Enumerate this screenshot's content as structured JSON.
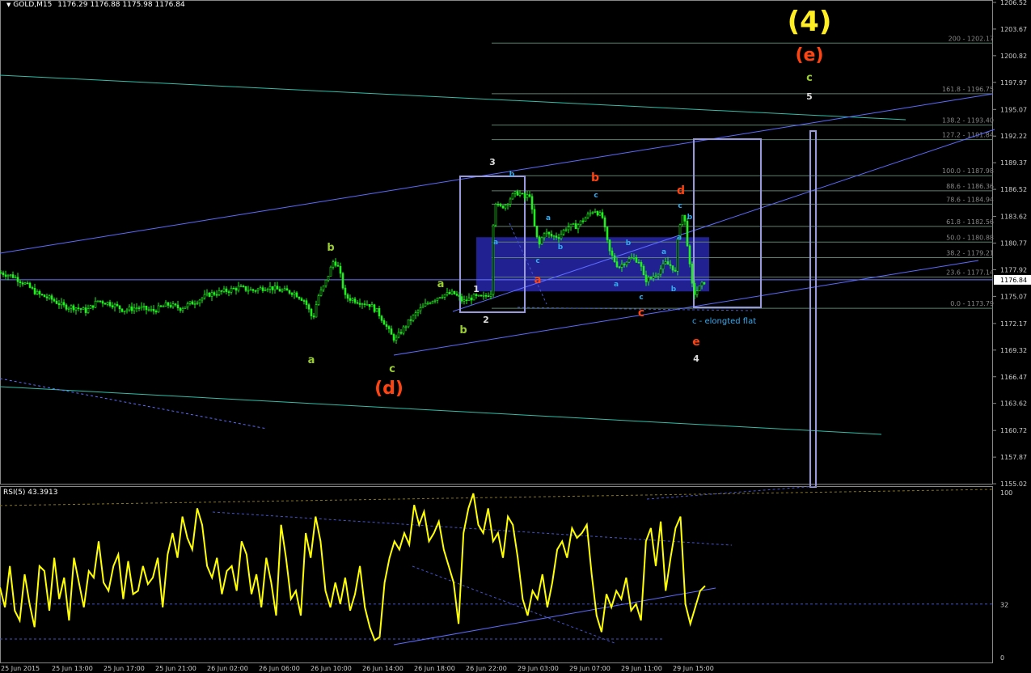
{
  "header": {
    "symbol": "GOLD,M15",
    "ohlc": "1176.29 1176.88 1175.98 1176.84",
    "rsi_label": "RSI(5) 43.3913"
  },
  "colors": {
    "background": "#000000",
    "candles": "#22ee22",
    "channel": "#5c6cff",
    "fib": "#5f7f6f",
    "box": "#9999dd",
    "zone": "#23239a",
    "rsi": "#ffff00",
    "count_green": "#9acd32",
    "count_red": "#ff4411",
    "count_cyan": "#33aaee",
    "wave4": "#ffee22"
  },
  "chart_data": [
    {
      "type": "line",
      "title": "GOLD,M15",
      "ylim": [
        1153.2,
        1207.5
      ],
      "y_ticks": [
        "1206.52",
        "1203.67",
        "1200.82",
        "1197.97",
        "1195.07",
        "1192.22",
        "1189.37",
        "1186.52",
        "1183.62",
        "1180.77",
        "1177.92",
        "1175.07",
        "1172.17",
        "1169.32",
        "1166.47",
        "1163.62",
        "1160.72",
        "1157.87",
        "1155.02"
      ],
      "current_price": "1176.84",
      "x_labels": [
        "25 Jun 2015",
        "25 Jun 13:00",
        "25 Jun 17:00",
        "25 Jun 21:00",
        "26 Jun 02:00",
        "26 Jun 06:00",
        "26 Jun 10:00",
        "26 Jun 14:00",
        "26 Jun 18:00",
        "26 Jun 22:00",
        "29 Jun 03:00",
        "29 Jun 07:00",
        "29 Jun 11:00",
        "29 Jun 15:00"
      ],
      "price_path": [
        [
          0,
          1177.6
        ],
        [
          16,
          1177.2
        ],
        [
          30,
          1176.4
        ],
        [
          46,
          1175.3
        ],
        [
          62,
          1174.8
        ],
        [
          78,
          1174.0
        ],
        [
          92,
          1173.9
        ],
        [
          106,
          1173.5
        ],
        [
          120,
          1174.6
        ],
        [
          136,
          1174.3
        ],
        [
          152,
          1173.6
        ],
        [
          170,
          1173.9
        ],
        [
          188,
          1173.5
        ],
        [
          206,
          1174.2
        ],
        [
          222,
          1173.8
        ],
        [
          240,
          1174.5
        ],
        [
          258,
          1175.3
        ],
        [
          276,
          1175.6
        ],
        [
          294,
          1176.0
        ],
        [
          312,
          1175.7
        ],
        [
          330,
          1176.1
        ],
        [
          346,
          1175.7
        ],
        [
          362,
          1175.5
        ],
        [
          376,
          1174.6
        ],
        [
          386,
          1172.6
        ],
        [
          392,
          1175.0
        ],
        [
          400,
          1176.2
        ],
        [
          406,
          1177.6
        ],
        [
          412,
          1179.0
        ],
        [
          418,
          1178.0
        ],
        [
          426,
          1175.0
        ],
        [
          440,
          1174.6
        ],
        [
          456,
          1174.2
        ],
        [
          466,
          1173.4
        ],
        [
          474,
          1172.3
        ],
        [
          482,
          1171.0
        ],
        [
          488,
          1170.4
        ],
        [
          494,
          1171.2
        ],
        [
          504,
          1172.3
        ],
        [
          516,
          1173.5
        ],
        [
          530,
          1174.5
        ],
        [
          544,
          1175.2
        ],
        [
          560,
          1175.4
        ],
        [
          572,
          1174.5
        ],
        [
          584,
          1175.0
        ],
        [
          596,
          1174.9
        ],
        [
          606,
          1175.5
        ],
        [
          610,
          1185.5
        ],
        [
          616,
          1184.5
        ],
        [
          624,
          1184.9
        ],
        [
          632,
          1185.8
        ],
        [
          640,
          1186.2
        ],
        [
          648,
          1185.6
        ],
        [
          654,
          1186.0
        ],
        [
          658,
          1183.5
        ],
        [
          662,
          1181.5
        ],
        [
          666,
          1180.6
        ],
        [
          672,
          1182.0
        ],
        [
          680,
          1181.5
        ],
        [
          690,
          1181.5
        ],
        [
          700,
          1182.5
        ],
        [
          712,
          1182.6
        ],
        [
          722,
          1183.4
        ],
        [
          734,
          1184.4
        ],
        [
          744,
          1183.5
        ],
        [
          752,
          1180.0
        ],
        [
          758,
          1179.0
        ],
        [
          764,
          1178.2
        ],
        [
          772,
          1178.8
        ],
        [
          782,
          1179.2
        ],
        [
          790,
          1178.8
        ],
        [
          796,
          1176.8
        ],
        [
          804,
          1177.0
        ],
        [
          814,
          1177.8
        ],
        [
          822,
          1178.6
        ],
        [
          830,
          1178.3
        ],
        [
          834,
          1177.6
        ],
        [
          838,
          1182.0
        ],
        [
          842,
          1184.0
        ],
        [
          846,
          1183.0
        ],
        [
          850,
          1180.0
        ],
        [
          854,
          1176.5
        ],
        [
          858,
          1175.4
        ],
        [
          864,
          1176.0
        ],
        [
          872,
          1176.84
        ]
      ],
      "fibonacci": [
        {
          "label": "200 - 1202.17",
          "price": 1202.17
        },
        {
          "label": "161.8 - 1196.75",
          "price": 1196.75
        },
        {
          "label": "138.2 - 1193.40",
          "price": 1193.4
        },
        {
          "label": "127.2 - 1191.84",
          "price": 1191.84
        },
        {
          "label": "100.0 - 1187.98",
          "price": 1187.98
        },
        {
          "label": "88.6 - 1186.36",
          "price": 1186.36
        },
        {
          "label": "78.6 - 1184.94",
          "price": 1184.94
        },
        {
          "label": "61.8 - 1182.56",
          "price": 1182.56
        },
        {
          "label": "50.0 - 1180.88",
          "price": 1180.88
        },
        {
          "label": "38.2 - 1179.21",
          "price": 1179.21
        },
        {
          "label": "23.6 - 1177.14",
          "price": 1177.14
        },
        {
          "label": "0.0 - 1173.79",
          "price": 1173.79
        }
      ],
      "annotations": {
        "wave4": "(4)",
        "wave_e_top": "(e)",
        "wave_d": "(d)",
        "green_a1": "a",
        "green_b1": "b",
        "green_c1": "c",
        "green_a2": "a",
        "green_b2": "b",
        "green_c_top": "c",
        "white_1": "1",
        "white_2": "2",
        "white_3": "3",
        "white_4": "4",
        "white_5": "5",
        "red_a": "a",
        "red_b": "b",
        "red_c": "c",
        "red_d": "d",
        "red_e": "e",
        "cyan_labels": [
          "a",
          "b",
          "a",
          "c",
          "b",
          "c",
          "a",
          "b",
          "c",
          "a",
          "b",
          "c",
          "a",
          "b"
        ],
        "note": "c - elongted flat"
      }
    },
    {
      "type": "line",
      "title": "RSI(5) 43.3913",
      "ylim": [
        0,
        100
      ],
      "y_ticks": [
        "100",
        "32",
        "0"
      ],
      "values": [
        42,
        30,
        55,
        28,
        22,
        50,
        32,
        18,
        55,
        52,
        28,
        60,
        35,
        48,
        22,
        60,
        45,
        30,
        52,
        48,
        70,
        45,
        40,
        55,
        62,
        35,
        58,
        38,
        40,
        55,
        44,
        48,
        60,
        30,
        62,
        75,
        60,
        85,
        72,
        65,
        90,
        80,
        55,
        48,
        60,
        38,
        52,
        55,
        40,
        70,
        62,
        38,
        50,
        30,
        60,
        45,
        25,
        80,
        60,
        35,
        40,
        25,
        75,
        60,
        85,
        70,
        40,
        30,
        45,
        32,
        48,
        28,
        38,
        55,
        30,
        18,
        10,
        12,
        45,
        60,
        70,
        65,
        75,
        68,
        92,
        80,
        88,
        70,
        75,
        82,
        65,
        55,
        45,
        20,
        75,
        90,
        99,
        80,
        75,
        90,
        70,
        75,
        60,
        85,
        80,
        60,
        35,
        25,
        40,
        35,
        50,
        30,
        45,
        65,
        70,
        60,
        78,
        72,
        75,
        80,
        50,
        25,
        15,
        38,
        30,
        40,
        35,
        48,
        28,
        32,
        22,
        70,
        78,
        55,
        82,
        40,
        60,
        78,
        85,
        32,
        20,
        30,
        40,
        43
      ]
    }
  ]
}
